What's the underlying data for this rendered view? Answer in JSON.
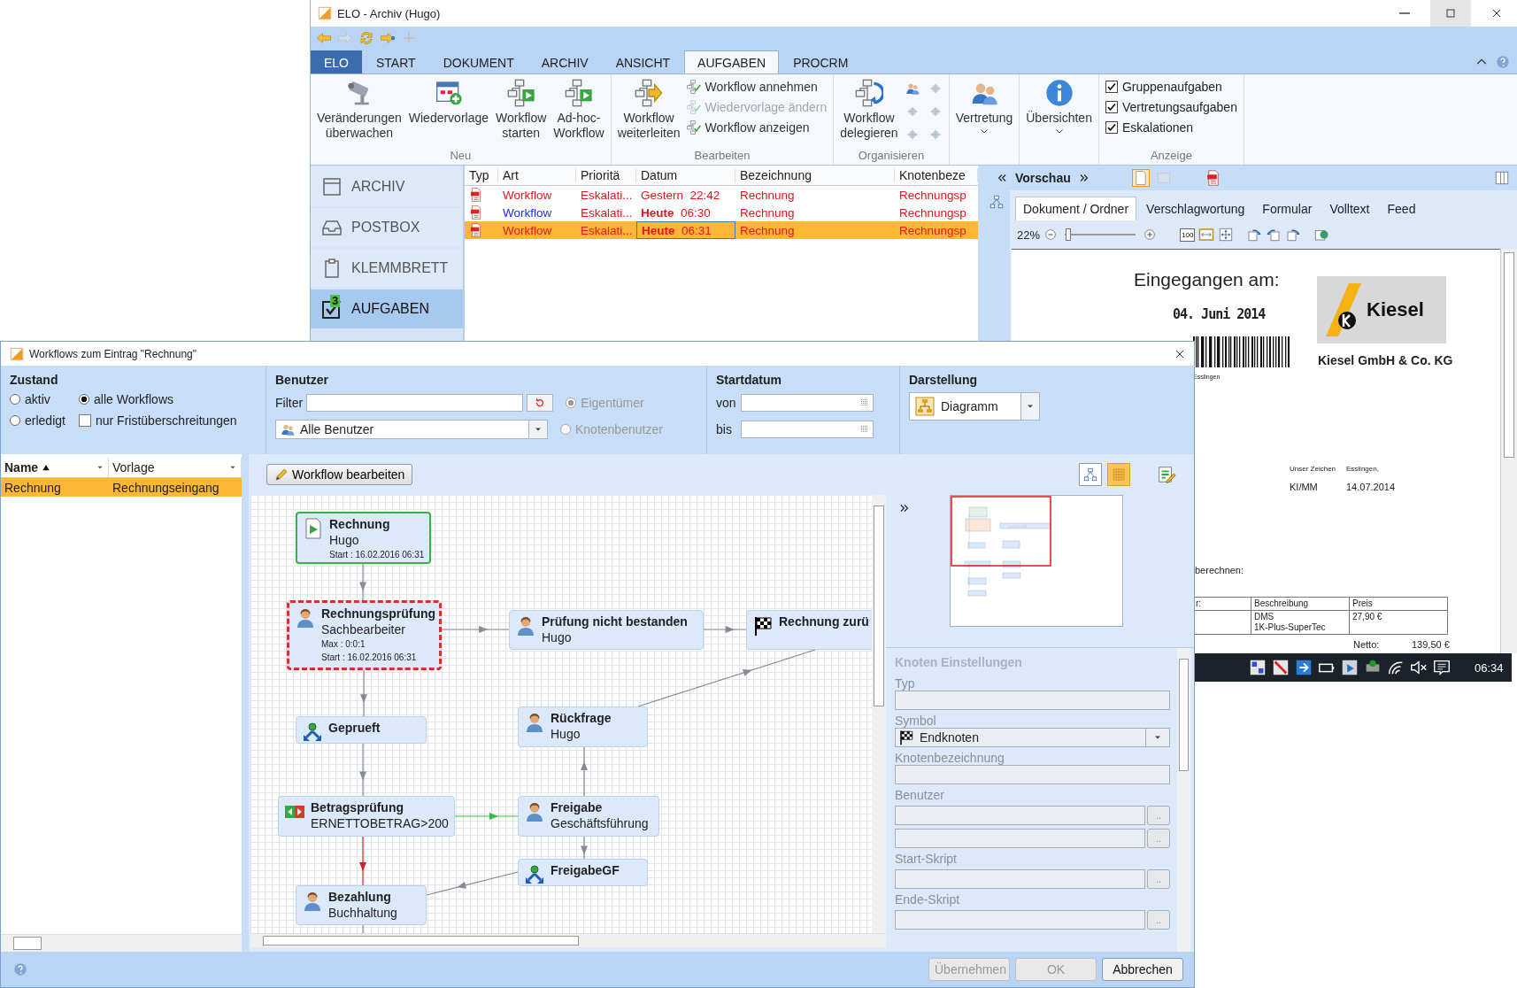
{
  "archive_window": {
    "title": "ELO - Archiv (Hugo)",
    "ribbon_tabs": [
      {
        "label": "ELO",
        "kind": "app",
        "selected": false
      },
      {
        "label": "START",
        "kind": "tab",
        "selected": false
      },
      {
        "label": "DOKUMENT",
        "kind": "tab",
        "selected": false
      },
      {
        "label": "ARCHIV",
        "kind": "tab",
        "selected": false
      },
      {
        "label": "ANSICHT",
        "kind": "tab",
        "selected": false
      },
      {
        "label": "AUFGABEN",
        "kind": "tab",
        "selected": true
      },
      {
        "label": "PROCRM",
        "kind": "tab",
        "selected": false
      }
    ],
    "ribbon_groups": [
      {
        "label": "Neu",
        "items": [
          {
            "kind": "large",
            "lines": [
              "Veränderungen",
              "überwachen"
            ]
          },
          {
            "kind": "large",
            "lines": [
              "Wiedervorlage"
            ]
          },
          {
            "kind": "large",
            "lines": [
              "Workflow",
              "starten"
            ]
          },
          {
            "kind": "large",
            "lines": [
              "Ad-hoc-",
              "Workflow"
            ]
          }
        ]
      },
      {
        "label": "Bearbeiten",
        "items": [
          {
            "kind": "large",
            "lines": [
              "Workflow",
              "weiterleiten"
            ]
          },
          {
            "kind": "stack",
            "entries": [
              {
                "label": "Workflow annehmen",
                "disabled": false
              },
              {
                "label": "Wiedervorlage ändern",
                "disabled": true
              },
              {
                "label": "Workflow anzeigen",
                "disabled": false
              }
            ]
          }
        ]
      },
      {
        "label": "Organisieren",
        "items": [
          {
            "kind": "large",
            "lines": [
              "Workflow",
              "delegieren"
            ]
          },
          {
            "kind": "icons"
          }
        ]
      },
      {
        "items": [
          {
            "kind": "menu",
            "lines": [
              "Vertretung"
            ]
          }
        ]
      },
      {
        "items": [
          {
            "kind": "menu",
            "lines": [
              "Übersichten"
            ]
          }
        ]
      },
      {
        "label": "Anzeige",
        "items": [
          {
            "kind": "checks",
            "entries": [
              {
                "label": "Gruppenaufgaben",
                "checked": true
              },
              {
                "label": "Vertretungsaufgaben",
                "checked": true
              },
              {
                "label": "Eskalationen",
                "checked": true
              }
            ]
          }
        ]
      }
    ],
    "nav": [
      {
        "label": "ARCHIV",
        "selected": false
      },
      {
        "label": "POSTBOX",
        "selected": false
      },
      {
        "label": "KLEMMBRETT",
        "selected": false
      },
      {
        "label": "AUFGABEN",
        "selected": true,
        "badge": "3"
      }
    ],
    "task_list": {
      "columns": [
        "Typ",
        "Art",
        "Prioritä",
        "Datum",
        "Bezeichnung",
        "Knotenbeze"
      ],
      "rows": [
        {
          "art": {
            "text": "Workflow",
            "accent": false
          },
          "priority": "Eskalati...",
          "date": "Gestern  22:42",
          "name": "Rechnung",
          "node": "Rechnungsp",
          "selected": false,
          "focused": false
        },
        {
          "art": {
            "text": "Workflow",
            "accent": true
          },
          "priority": "Eskalati...",
          "date": "**Heute**  06:30",
          "name": "Rechnung",
          "node": "Rechnungsp",
          "selected": false,
          "focused": false
        },
        {
          "art": {
            "text": "Workflow",
            "accent": false
          },
          "priority": "Eskalati...",
          "date": "**Heute**  06:31",
          "name": "Rechnung",
          "node": "Rechnungsp",
          "selected": true,
          "focused": true
        }
      ]
    },
    "preview": {
      "title": "Vorschau",
      "tabs": [
        {
          "label": "Dokument / Ordner",
          "selected": true
        },
        {
          "label": "Verschlagwortung",
          "selected": false
        },
        {
          "label": "Formular",
          "selected": false
        },
        {
          "label": "Volltext",
          "selected": false
        },
        {
          "label": "Feed",
          "selected": false
        }
      ],
      "zoom": "22%",
      "zoom_slider": {
        "level": 0.05
      },
      "actual_size_label": "100",
      "document": {
        "received_label": "Eingegangen am:",
        "stamp_date": "04. Juni 2014",
        "city_small": "Esslingen",
        "logo_text": "Kiesel",
        "company": "Kiesel GmbH & Co. KG",
        "reference_label": "Unser Zeichen",
        "place_label": "Esslingen,",
        "reference": "KI/MM",
        "date": "14.07.2014",
        "sentence_end": "berechnen:",
        "table": {
          "columns": [
            "r:",
            "Beschreibung",
            "Preis"
          ],
          "rows": [
            {
              "description_lines": [
                "DMS",
                "1K-Plus-SuperTec"
              ],
              "price": "27,90 €"
            }
          ]
        },
        "net_label": "Netto:",
        "net_value": "139,50 €"
      }
    }
  },
  "taskbar": {
    "time": "06:34"
  },
  "dialog": {
    "title": "Workflows zum Eintrag \"Rechnung\"",
    "state_filter": {
      "label": "Zustand",
      "options": [
        {
          "kind": "radio",
          "label": "aktiv",
          "selected": false
        },
        {
          "kind": "radio",
          "label": "alle Workflows",
          "selected": true
        },
        {
          "kind": "radio",
          "label": "erledigt",
          "selected": false
        },
        {
          "kind": "checkbox",
          "label": "nur Fristüberschreitungen",
          "checked": false
        }
      ]
    },
    "user_filter": {
      "label": "Benutzer",
      "filter_label": "Filter",
      "user_select": "Alle Benutzer",
      "roles": [
        {
          "label": "Eigentümer",
          "selected": true,
          "disabled": true
        },
        {
          "label": "Knotenbenutzer",
          "selected": false,
          "disabled": true
        }
      ]
    },
    "date_filter": {
      "label": "Startdatum",
      "from_label": "von",
      "to_label": "bis"
    },
    "view": {
      "label": "Darstellung",
      "value": "Diagramm"
    },
    "workflow_list": {
      "columns": [
        {
          "label": "Name",
          "sorted": true
        },
        {
          "label": "Vorlage",
          "sorted": false
        }
      ],
      "rows": [
        {
          "name": "Rechnung",
          "template": "Rechnungseingang",
          "selected": true
        }
      ]
    },
    "edit_button": "Workflow bearbeiten",
    "view_modes": [
      {
        "kind": "tree",
        "selected": false
      },
      {
        "kind": "grid",
        "selected": true
      }
    ],
    "nodes": [
      {
        "kind": "start",
        "title": "Rechnung",
        "subtitle": "Hugo",
        "details": [
          "Start : 16.02.2016 06:31"
        ],
        "active": true,
        "overdue": false
      },
      {
        "kind": "person",
        "title": "Rechnungsprüfung",
        "subtitle": "Sachbearbeiter",
        "details": [
          "Max : 0:0:1",
          "Start : 16.02.2016 06:31"
        ],
        "active": false,
        "overdue": true
      },
      {
        "kind": "person",
        "title": "Prüfung nicht bestanden",
        "subtitle": "Hugo",
        "active": false,
        "overdue": false
      },
      {
        "kind": "end",
        "title": "Rechnung zurü",
        "active": false,
        "overdue": false
      },
      {
        "kind": "split",
        "title": "Geprueft",
        "active": false,
        "overdue": false
      },
      {
        "kind": "person",
        "title": "Rückfrage",
        "subtitle": "Hugo",
        "active": false,
        "overdue": false
      },
      {
        "kind": "decision",
        "title": "Betragsprüfung",
        "subtitle": "ERNETTOBETRAG>200",
        "active": false,
        "overdue": false
      },
      {
        "kind": "person",
        "title": "Freigabe",
        "subtitle": "Geschäftsführung",
        "active": false,
        "overdue": false
      },
      {
        "kind": "split",
        "title": "FreigabeGF",
        "active": false,
        "overdue": false
      },
      {
        "kind": "person",
        "title": "Bezahlung",
        "subtitle": "Buchhaltung",
        "active": false,
        "overdue": false
      }
    ],
    "settings": {
      "title": "Knoten Einstellungen",
      "disabled": true,
      "fields": [
        {
          "kind": "text",
          "label": "Typ"
        },
        {
          "kind": "select",
          "label": "Symbol",
          "value": "Endknoten"
        },
        {
          "kind": "text",
          "label": "Knotenbezeichnung"
        },
        {
          "kind": "browse",
          "label": "Benutzer",
          "browse_label": ".."
        },
        {
          "kind": "browse",
          "browse_label": ".."
        },
        {
          "kind": "browse",
          "label": "Start-Skript",
          "browse_label": ".."
        },
        {
          "kind": "browse",
          "label": "Ende-Skript",
          "browse_label": ".."
        }
      ]
    },
    "buttons": [
      {
        "label": "Übernehmen",
        "disabled": true
      },
      {
        "label": "OK",
        "disabled": true
      },
      {
        "label": "Abbrechen",
        "disabled": false
      }
    ]
  }
}
